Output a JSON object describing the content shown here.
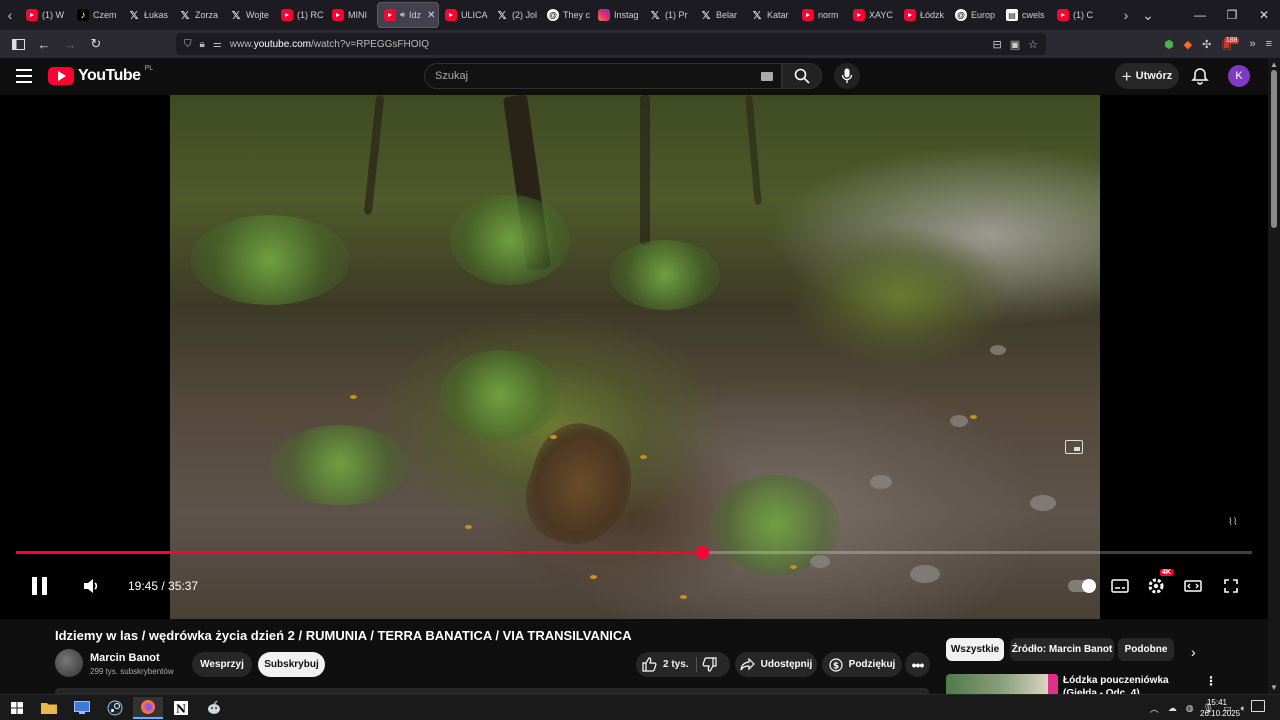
{
  "browser": {
    "tabs": [
      {
        "icon": "yt",
        "label": "(1) W"
      },
      {
        "icon": "tt",
        "label": "Czem"
      },
      {
        "icon": "x",
        "label": "Łukas"
      },
      {
        "icon": "x",
        "label": "Zorza"
      },
      {
        "icon": "x",
        "label": "Wojte"
      },
      {
        "icon": "yt",
        "label": "(1) RC"
      },
      {
        "icon": "yt",
        "label": "MINI"
      },
      {
        "icon": "yt",
        "label": "Idz",
        "active": true
      },
      {
        "icon": "yt",
        "label": "ULICA"
      },
      {
        "icon": "x",
        "label": "(2) Jol"
      },
      {
        "icon": "th",
        "label": "They c"
      },
      {
        "icon": "ig",
        "label": "Instag"
      },
      {
        "icon": "x",
        "label": "(1) Pr"
      },
      {
        "icon": "x",
        "label": "Belar"
      },
      {
        "icon": "x",
        "label": "Katar"
      },
      {
        "icon": "yt",
        "label": "norm"
      },
      {
        "icon": "yt",
        "label": "XAYC"
      },
      {
        "icon": "yt",
        "label": "Łódzk"
      },
      {
        "icon": "th",
        "label": "Europ"
      },
      {
        "icon": "doc",
        "label": "cwels"
      },
      {
        "icon": "yt",
        "label": "(1) C"
      }
    ],
    "url_prefix": "www.",
    "url_domain": "youtube.com",
    "url_path": "/watch?v=RPEGGsFHOIQ",
    "extension_badge": "188"
  },
  "youtube": {
    "logo_text": "YouTube",
    "logo_country": "PL",
    "search_placeholder": "Szukaj",
    "create_label": "Utwórz",
    "avatar_letter": "K"
  },
  "player": {
    "current_time": "19:45",
    "duration": "35:37",
    "time_separator": " / ",
    "progress_fraction": 0.555,
    "quality_badge": "4K",
    "watermark": "⌇⌇"
  },
  "video": {
    "title": "Idziemy w las / wędrówka życia dzień 2 / RUMUNIA / TERRA BANATICA / VIA TRANSILVANICA",
    "channel_name": "Marcin Banot",
    "subscribers": "299 tys. subskrybentów",
    "support_label": "Wesprzyj",
    "subscribe_label": "Subskrybuj",
    "likes": "2 tys.",
    "share_label": "Udostępnij",
    "thanks_label": "Podziękuj"
  },
  "chips": [
    "Wszystkie",
    "Źródło: Marcin Banot",
    "Podobne"
  ],
  "recommendation": {
    "title": "Łódzka pouczeniówka (Giełda - Odc. 4)"
  },
  "taskbar": {
    "time": "15:41",
    "date": "26.10.2025"
  },
  "colors": {
    "accent": "#ff0033",
    "background": "#0f0f0f"
  }
}
